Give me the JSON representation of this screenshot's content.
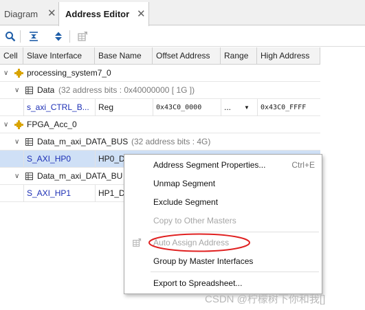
{
  "tabs": [
    {
      "label": "Diagram",
      "active": false
    },
    {
      "label": "Address Editor",
      "active": true
    }
  ],
  "toolbar": {
    "buttons": [
      "search-icon",
      "collapse-all-icon",
      "expand-all-icon",
      "auto-assign-icon"
    ]
  },
  "columns": [
    "Cell",
    "Slave Interface",
    "Base Name",
    "Offset Address",
    "Range",
    "High Address"
  ],
  "rows": [
    {
      "level": 0,
      "icon": "ip-block-icon",
      "name": "processing_system7_0"
    },
    {
      "level": 1,
      "icon": "address-space-icon",
      "name": "Data",
      "detail": "(32 address bits : 0x40000000 [ 1G ])"
    },
    {
      "slave": "s_axi_CTRL_B...",
      "base_name": "Reg",
      "offset": "0x43C0_0000",
      "range": "...",
      "high": "0x43C0_FFFF"
    },
    {
      "level": 0,
      "icon": "ip-block-icon",
      "name": "FPGA_Acc_0"
    },
    {
      "level": 1,
      "icon": "address-space-icon",
      "name": "Data_m_axi_DATA_BUS",
      "detail": "(32 address bits : 4G)"
    },
    {
      "slave": "S_AXI_HP0",
      "base_name": "HP0_D",
      "selected": true
    },
    {
      "level": 1,
      "icon": "address-space-icon",
      "name": "Data_m_axi_DATA_BU"
    },
    {
      "slave": "S_AXI_HP1",
      "base_name": "HP1_D"
    }
  ],
  "context_menu": {
    "items": [
      {
        "label": "Address Segment Properties...",
        "shortcut": "Ctrl+E",
        "enabled": true
      },
      {
        "label": "Unmap Segment",
        "enabled": true
      },
      {
        "label": "Exclude Segment",
        "enabled": true
      },
      {
        "label": "Copy to Other Masters",
        "enabled": false
      },
      {
        "label": "Auto Assign Address",
        "enabled": false,
        "highlighted": true
      },
      {
        "label": "Group by Master Interfaces",
        "enabled": true
      },
      {
        "label": "Export to Spreadsheet...",
        "enabled": true
      }
    ]
  },
  "colors": {
    "selection": "#cfe0f6",
    "link": "#1c2fb5",
    "highlight_circle": "#e02020",
    "ip_icon": "#d9a400"
  },
  "watermark": "CSDN @柠檬树下你和我[]"
}
